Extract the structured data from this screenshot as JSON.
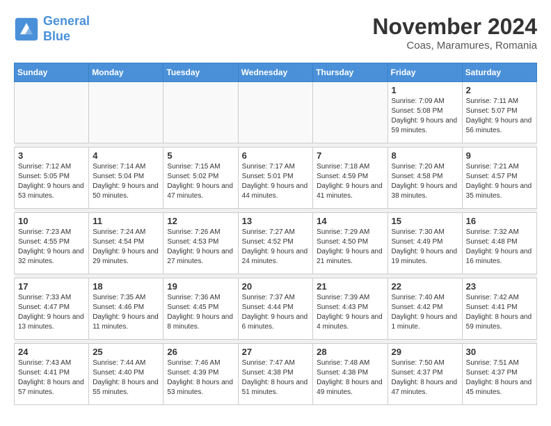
{
  "header": {
    "logo_line1": "General",
    "logo_line2": "Blue",
    "month_title": "November 2024",
    "location": "Coas, Maramures, Romania"
  },
  "weekdays": [
    "Sunday",
    "Monday",
    "Tuesday",
    "Wednesday",
    "Thursday",
    "Friday",
    "Saturday"
  ],
  "weeks": [
    [
      {
        "day": "",
        "info": ""
      },
      {
        "day": "",
        "info": ""
      },
      {
        "day": "",
        "info": ""
      },
      {
        "day": "",
        "info": ""
      },
      {
        "day": "",
        "info": ""
      },
      {
        "day": "1",
        "info": "Sunrise: 7:09 AM\nSunset: 5:08 PM\nDaylight: 9 hours and 59 minutes."
      },
      {
        "day": "2",
        "info": "Sunrise: 7:11 AM\nSunset: 5:07 PM\nDaylight: 9 hours and 56 minutes."
      }
    ],
    [
      {
        "day": "3",
        "info": "Sunrise: 7:12 AM\nSunset: 5:05 PM\nDaylight: 9 hours and 53 minutes."
      },
      {
        "day": "4",
        "info": "Sunrise: 7:14 AM\nSunset: 5:04 PM\nDaylight: 9 hours and 50 minutes."
      },
      {
        "day": "5",
        "info": "Sunrise: 7:15 AM\nSunset: 5:02 PM\nDaylight: 9 hours and 47 minutes."
      },
      {
        "day": "6",
        "info": "Sunrise: 7:17 AM\nSunset: 5:01 PM\nDaylight: 9 hours and 44 minutes."
      },
      {
        "day": "7",
        "info": "Sunrise: 7:18 AM\nSunset: 4:59 PM\nDaylight: 9 hours and 41 minutes."
      },
      {
        "day": "8",
        "info": "Sunrise: 7:20 AM\nSunset: 4:58 PM\nDaylight: 9 hours and 38 minutes."
      },
      {
        "day": "9",
        "info": "Sunrise: 7:21 AM\nSunset: 4:57 PM\nDaylight: 9 hours and 35 minutes."
      }
    ],
    [
      {
        "day": "10",
        "info": "Sunrise: 7:23 AM\nSunset: 4:55 PM\nDaylight: 9 hours and 32 minutes."
      },
      {
        "day": "11",
        "info": "Sunrise: 7:24 AM\nSunset: 4:54 PM\nDaylight: 9 hours and 29 minutes."
      },
      {
        "day": "12",
        "info": "Sunrise: 7:26 AM\nSunset: 4:53 PM\nDaylight: 9 hours and 27 minutes."
      },
      {
        "day": "13",
        "info": "Sunrise: 7:27 AM\nSunset: 4:52 PM\nDaylight: 9 hours and 24 minutes."
      },
      {
        "day": "14",
        "info": "Sunrise: 7:29 AM\nSunset: 4:50 PM\nDaylight: 9 hours and 21 minutes."
      },
      {
        "day": "15",
        "info": "Sunrise: 7:30 AM\nSunset: 4:49 PM\nDaylight: 9 hours and 19 minutes."
      },
      {
        "day": "16",
        "info": "Sunrise: 7:32 AM\nSunset: 4:48 PM\nDaylight: 9 hours and 16 minutes."
      }
    ],
    [
      {
        "day": "17",
        "info": "Sunrise: 7:33 AM\nSunset: 4:47 PM\nDaylight: 9 hours and 13 minutes."
      },
      {
        "day": "18",
        "info": "Sunrise: 7:35 AM\nSunset: 4:46 PM\nDaylight: 9 hours and 11 minutes."
      },
      {
        "day": "19",
        "info": "Sunrise: 7:36 AM\nSunset: 4:45 PM\nDaylight: 9 hours and 8 minutes."
      },
      {
        "day": "20",
        "info": "Sunrise: 7:37 AM\nSunset: 4:44 PM\nDaylight: 9 hours and 6 minutes."
      },
      {
        "day": "21",
        "info": "Sunrise: 7:39 AM\nSunset: 4:43 PM\nDaylight: 9 hours and 4 minutes."
      },
      {
        "day": "22",
        "info": "Sunrise: 7:40 AM\nSunset: 4:42 PM\nDaylight: 9 hours and 1 minute."
      },
      {
        "day": "23",
        "info": "Sunrise: 7:42 AM\nSunset: 4:41 PM\nDaylight: 8 hours and 59 minutes."
      }
    ],
    [
      {
        "day": "24",
        "info": "Sunrise: 7:43 AM\nSunset: 4:41 PM\nDaylight: 8 hours and 57 minutes."
      },
      {
        "day": "25",
        "info": "Sunrise: 7:44 AM\nSunset: 4:40 PM\nDaylight: 8 hours and 55 minutes."
      },
      {
        "day": "26",
        "info": "Sunrise: 7:46 AM\nSunset: 4:39 PM\nDaylight: 8 hours and 53 minutes."
      },
      {
        "day": "27",
        "info": "Sunrise: 7:47 AM\nSunset: 4:38 PM\nDaylight: 8 hours and 51 minutes."
      },
      {
        "day": "28",
        "info": "Sunrise: 7:48 AM\nSunset: 4:38 PM\nDaylight: 8 hours and 49 minutes."
      },
      {
        "day": "29",
        "info": "Sunrise: 7:50 AM\nSunset: 4:37 PM\nDaylight: 8 hours and 47 minutes."
      },
      {
        "day": "30",
        "info": "Sunrise: 7:51 AM\nSunset: 4:37 PM\nDaylight: 8 hours and 45 minutes."
      }
    ]
  ]
}
